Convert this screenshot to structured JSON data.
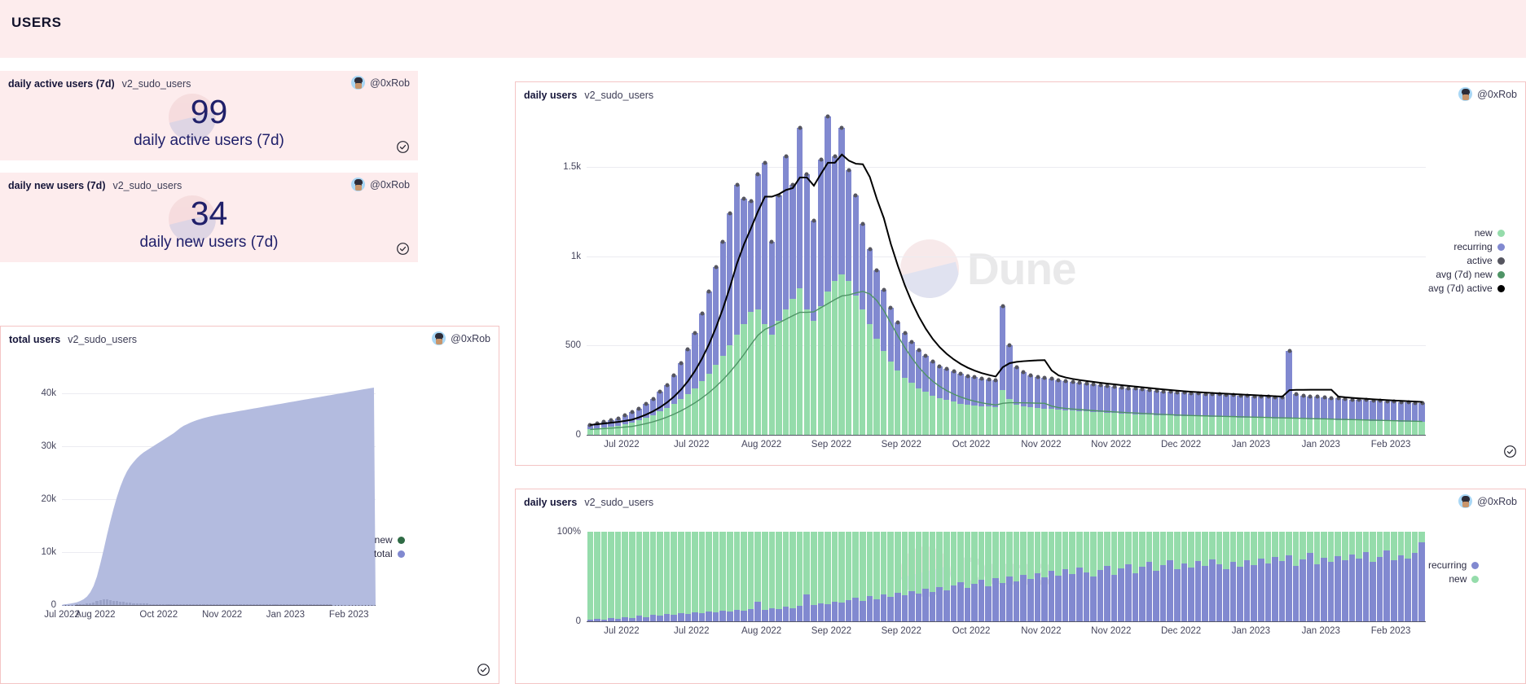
{
  "header": {
    "title": "USERS"
  },
  "user": {
    "handle": "@0xRob",
    "avatar_icon": "pixel-avatar-icon"
  },
  "icons": {
    "check": "check-circle-icon"
  },
  "watermark": {
    "text": "Dune"
  },
  "colors": {
    "header_bg": "#fdeced",
    "card_border": "#f4c5c5",
    "counter_text": "#20206a",
    "new": "#95dcab",
    "recurring": "#8189d0",
    "active": "#55555f",
    "avg_new": "#4f9466",
    "avg_active": "#000000",
    "total_area": "#b3bbdf"
  },
  "cards": {
    "daily_active_counter": {
      "title": "daily active users (7d)",
      "subtitle": "v2_sudo_users",
      "value": "99",
      "label": "daily active users (7d)"
    },
    "daily_new_counter": {
      "title": "daily new users (7d)",
      "subtitle": "v2_sudo_users",
      "value": "34",
      "label": "daily new users (7d)"
    },
    "total_users": {
      "title": "total users",
      "subtitle": "v2_sudo_users"
    },
    "daily_users_main": {
      "title": "daily users",
      "subtitle": "v2_sudo_users"
    },
    "daily_users_pct": {
      "title": "daily users",
      "subtitle": "v2_sudo_users"
    }
  },
  "chart_data": [
    {
      "id": "total_users",
      "type": "area",
      "title": "total users",
      "xlabel": "",
      "ylabel": "",
      "ylim": [
        0,
        43000
      ],
      "yticks": [
        0,
        10000,
        20000,
        30000,
        40000
      ],
      "ytick_labels": [
        "0",
        "10k",
        "20k",
        "30k",
        "40k"
      ],
      "xtick_labels": [
        "Jul 2022",
        "Aug 2022",
        "Oct 2022",
        "Nov 2022",
        "Jan 2023",
        "Feb 2023"
      ],
      "xtick_positions": [
        0,
        10,
        29,
        48,
        67,
        86
      ],
      "grid": true,
      "legend_position": "right",
      "legend": [
        {
          "name": "new",
          "color": "#2f6b45"
        },
        {
          "name": "total",
          "color": "#8189d0"
        }
      ],
      "series": [
        {
          "name": "total",
          "kind": "area",
          "values": [
            120,
            180,
            260,
            380,
            520,
            760,
            1100,
            1600,
            2400,
            3600,
            5400,
            7800,
            10400,
            13200,
            15800,
            18200,
            20400,
            22300,
            23900,
            25200,
            26200,
            27000,
            27700,
            28300,
            28800,
            29200,
            29600,
            30000,
            30400,
            30800,
            31200,
            31600,
            32000,
            32400,
            32900,
            33400,
            33800,
            34100,
            34400,
            34650,
            34880,
            35080,
            35260,
            35420,
            35570,
            35710,
            35840,
            35960,
            36070,
            36180,
            36290,
            36400,
            36510,
            36620,
            36730,
            36840,
            36950,
            37060,
            37170,
            37280,
            37390,
            37500,
            37610,
            37720,
            37830,
            37940,
            38050,
            38160,
            38270,
            38380,
            38490,
            38600,
            38710,
            38820,
            38930,
            39040,
            39150,
            39260,
            39370,
            39480,
            39590,
            39700,
            39810,
            39920,
            40030,
            40140,
            40250,
            40360,
            40470,
            40580,
            40690,
            40800,
            40900,
            41000
          ]
        },
        {
          "name": "new",
          "kind": "bar",
          "values": [
            20,
            30,
            45,
            60,
            90,
            130,
            190,
            270,
            380,
            520,
            700,
            900,
            1050,
            1150,
            1000,
            820,
            700,
            640,
            560,
            500,
            420,
            380,
            340,
            300,
            280,
            250,
            230,
            210,
            200,
            190,
            180,
            175,
            170,
            165,
            160,
            158,
            155,
            150,
            148,
            145,
            142,
            140,
            138,
            135,
            133,
            130,
            128,
            126,
            124,
            122,
            120,
            118,
            116,
            114,
            112,
            110,
            108,
            106,
            104,
            102,
            100,
            99,
            98,
            97,
            96,
            95,
            94,
            93,
            92,
            91,
            90,
            89,
            88,
            87,
            86,
            85,
            84,
            83,
            82,
            81,
            80,
            79,
            78,
            77,
            76,
            75,
            74,
            73,
            72,
            71,
            70,
            69,
            68,
            67
          ]
        }
      ]
    },
    {
      "id": "daily_users_main",
      "type": "bar",
      "title": "daily users",
      "stacked": true,
      "xlabel": "",
      "ylabel": "",
      "ylim": [
        0,
        1800
      ],
      "yticks": [
        0,
        500,
        1000,
        1500
      ],
      "ytick_labels": [
        "0",
        "500",
        "1k",
        "1.5k"
      ],
      "xtick_labels": [
        "Jul 2022",
        "Jul 2022",
        "Aug 2022",
        "Sep 2022",
        "Sep 2022",
        "Oct 2022",
        "Nov 2022",
        "Nov 2022",
        "Dec 2022",
        "Jan 2023",
        "Jan 2023",
        "Feb 2023"
      ],
      "grid": true,
      "legend_position": "right",
      "legend": [
        {
          "name": "new",
          "color": "#95dcab"
        },
        {
          "name": "recurring",
          "color": "#8189d0"
        },
        {
          "name": "active",
          "color": "#55555f"
        },
        {
          "name": "avg (7d) new",
          "color": "#4f9466"
        },
        {
          "name": "avg (7d) active",
          "color": "#000000"
        }
      ],
      "series": [
        {
          "name": "new",
          "values": [
            30,
            35,
            40,
            45,
            50,
            60,
            70,
            80,
            95,
            110,
            130,
            150,
            175,
            200,
            230,
            260,
            300,
            340,
            390,
            440,
            500,
            560,
            620,
            690,
            700,
            620,
            560,
            640,
            700,
            760,
            820,
            700,
            640,
            720,
            800,
            860,
            900,
            860,
            780,
            700,
            620,
            540,
            470,
            410,
            360,
            320,
            290,
            260,
            240,
            220,
            205,
            195,
            185,
            175,
            170,
            165,
            160,
            158,
            155,
            250,
            200,
            170,
            160,
            155,
            150,
            148,
            145,
            140,
            138,
            135,
            133,
            130,
            128,
            126,
            124,
            122,
            120,
            118,
            116,
            114,
            112,
            110,
            109,
            108,
            107,
            106,
            105,
            104,
            103,
            102,
            101,
            100,
            99,
            98,
            97,
            96,
            95,
            94,
            93,
            92,
            91,
            90,
            89,
            88,
            87,
            86,
            85,
            84,
            83,
            82,
            81,
            80,
            79,
            78,
            77,
            76,
            75,
            74,
            73,
            72
          ]
        },
        {
          "name": "recurring",
          "values": [
            25,
            28,
            32,
            36,
            40,
            48,
            56,
            64,
            76,
            90,
            110,
            130,
            160,
            200,
            250,
            310,
            380,
            460,
            550,
            640,
            740,
            840,
            700,
            620,
            760,
            900,
            520,
            700,
            860,
            640,
            900,
            760,
            560,
            820,
            980,
            700,
            820,
            620,
            560,
            480,
            420,
            380,
            340,
            300,
            270,
            250,
            230,
            215,
            200,
            190,
            180,
            175,
            170,
            165,
            160,
            158,
            156,
            154,
            152,
            470,
            300,
            210,
            190,
            180,
            175,
            170,
            168,
            165,
            162,
            160,
            158,
            156,
            154,
            152,
            150,
            148,
            146,
            144,
            142,
            140,
            138,
            136,
            134,
            132,
            131,
            130,
            129,
            128,
            127,
            126,
            125,
            124,
            123,
            122,
            121,
            120,
            119,
            118,
            117,
            116,
            380,
            140,
            130,
            128,
            126,
            124,
            122,
            120,
            118,
            116,
            115,
            114,
            113,
            112,
            111,
            110,
            109,
            108,
            107,
            106
          ]
        }
      ]
    },
    {
      "id": "daily_users_pct",
      "type": "bar",
      "stacked": true,
      "normalized": true,
      "title": "daily users",
      "xlabel": "",
      "ylabel": "",
      "ylim": [
        0,
        100
      ],
      "yticks": [
        0,
        100
      ],
      "ytick_labels": [
        "0",
        "100%"
      ],
      "xtick_labels": [
        "Jul 2022",
        "Jul 2022",
        "Aug 2022",
        "Sep 2022",
        "Sep 2022",
        "Oct 2022",
        "Nov 2022",
        "Nov 2022",
        "Dec 2022",
        "Jan 2023",
        "Jan 2023",
        "Feb 2023"
      ],
      "grid": false,
      "legend_position": "right",
      "legend": [
        {
          "name": "recurring",
          "color": "#8189d0"
        },
        {
          "name": "new",
          "color": "#95dcab"
        }
      ],
      "series": [
        {
          "name": "recurring",
          "values": [
            2,
            3,
            2,
            4,
            3,
            5,
            4,
            6,
            5,
            7,
            6,
            8,
            7,
            9,
            8,
            10,
            9,
            11,
            10,
            12,
            11,
            13,
            12,
            14,
            22,
            13,
            15,
            14,
            16,
            15,
            17,
            30,
            18,
            20,
            19,
            22,
            21,
            24,
            26,
            23,
            28,
            25,
            30,
            27,
            32,
            29,
            34,
            31,
            36,
            33,
            38,
            35,
            40,
            44,
            37,
            42,
            46,
            39,
            48,
            43,
            50,
            45,
            52,
            47,
            54,
            49,
            56,
            51,
            58,
            53,
            60,
            55,
            50,
            57,
            62,
            52,
            59,
            64,
            54,
            61,
            66,
            56,
            63,
            68,
            58,
            65,
            60,
            67,
            62,
            69,
            64,
            58,
            66,
            61,
            68,
            63,
            70,
            65,
            72,
            67,
            74,
            62,
            69,
            76,
            64,
            71,
            66,
            73,
            68,
            75,
            70,
            77,
            66,
            72,
            79,
            68,
            74,
            70,
            76,
            88
          ]
        }
      ]
    }
  ]
}
